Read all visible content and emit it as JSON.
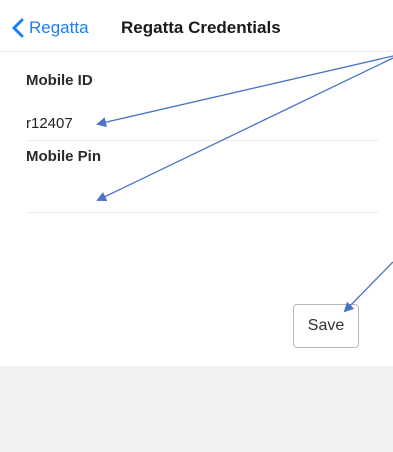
{
  "nav": {
    "back_label": "Regatta",
    "title": "Regatta Credentials"
  },
  "form": {
    "mobile_id_label": "Mobile ID",
    "mobile_id_value": "r12407",
    "mobile_pin_label": "Mobile Pin",
    "mobile_pin_value": ""
  },
  "actions": {
    "save_label": "Save"
  },
  "colors": {
    "accent": "#1a7ff5",
    "annotation_arrow": "#4a73c4",
    "footer_background": "#f2f2f2"
  },
  "icons": {
    "back": "chevron-left-icon"
  }
}
